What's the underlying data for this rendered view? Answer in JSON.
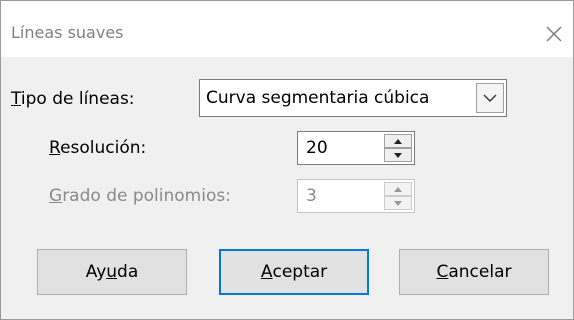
{
  "dialog": {
    "title": "Líneas suaves",
    "line_type": {
      "label_prefix": "T",
      "label_rest": "ipo de líneas:",
      "value": "Curva segmentaria cúbica"
    },
    "resolution": {
      "label_prefix": "R",
      "label_rest": "esolución:",
      "value": "20"
    },
    "polynomial_degree": {
      "label_prefix": "G",
      "label_rest": "rado de polinomios:",
      "value": "3"
    }
  },
  "buttons": {
    "help_pre": "Ay",
    "help_mnemonic": "u",
    "help_post": "da",
    "ok_mnemonic": "A",
    "ok_rest": "ceptar",
    "cancel_mnemonic": "C",
    "cancel_rest": "ancelar"
  },
  "icons": {
    "close": "close-icon",
    "combo_arrow": "chevron-down-icon",
    "spin_up": "triangle-up-icon",
    "spin_down": "triangle-down-icon"
  },
  "colors": {
    "accent": "#0078d7"
  }
}
